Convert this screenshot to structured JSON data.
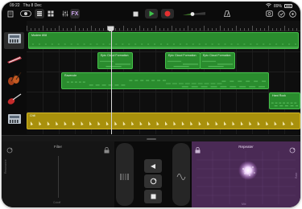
{
  "status": {
    "time": "09:22",
    "date": "Thu 8 Dec",
    "battery": "89%"
  },
  "toolbar": {
    "fx_label": "FX",
    "icons": [
      "document-icon",
      "browser-icon",
      "tracks-view-icon",
      "grid-view-icon",
      "mixer-icon",
      "rewind-icon",
      "play-icon",
      "record-icon",
      "volume-slider",
      "metronome-icon",
      "loop-icon",
      "settings-icon",
      "help-icon"
    ]
  },
  "tracks": [
    {
      "instrument": "keyboard-icon",
      "regions": [
        {
          "label": "Modern 808",
          "color": "green"
        }
      ]
    },
    {
      "instrument": "synth-icon",
      "regions": [
        {
          "label": "Epic Cloud Formation",
          "color": "green"
        },
        {
          "label": "Epic Cloud Formation",
          "color": "green"
        },
        {
          "label": "Epic Cloud Formation",
          "color": "green"
        }
      ]
    },
    {
      "instrument": "strings-icon",
      "regions": [
        {
          "label": "Ravenole",
          "color": "green"
        }
      ]
    },
    {
      "instrument": "guitar-icon",
      "regions": [
        {
          "label": "Hard Rock",
          "color": "green"
        }
      ]
    },
    {
      "instrument": "keyboard-icon",
      "regions": [
        {
          "label": "Chill",
          "color": "gold"
        }
      ]
    }
  ],
  "filter": {
    "title": "Filter",
    "y_label": "Resonance",
    "x_label": "Cutoff"
  },
  "repeater": {
    "title": "Repeater",
    "y_label": "Rate",
    "x_label": "Mix"
  },
  "mid_controls": [
    "rewind-pad-icon",
    "loop-pad-icon",
    "stop-pad-icon",
    "sine-pad-icon"
  ],
  "colors": {
    "region_green": "#2a8c2e",
    "region_gold": "#a8900c",
    "repeater_bg": "#4a2a55",
    "play": "#3ec24a",
    "record": "#e53030"
  }
}
